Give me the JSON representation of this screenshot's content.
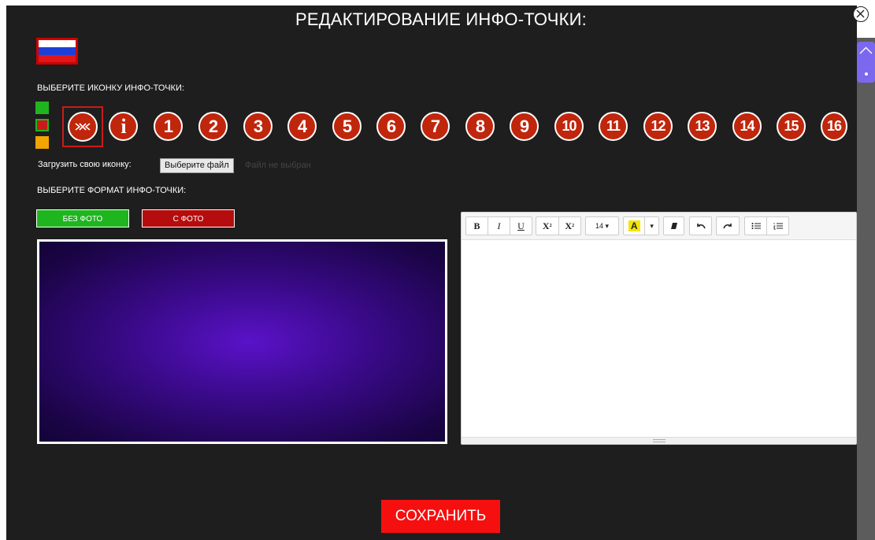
{
  "title": "РЕДАКТИРОВАНИЕ ИНФО-ТОЧКИ:",
  "close_icon": "close-circle-icon",
  "flag_icon": "russian-flag-icon",
  "flag_colors": [
    "#ffffff",
    "#1e3fd6",
    "#e0161b"
  ],
  "icon_section_label": "ВЫБЕРИТЕ ИКОНКУ ИНФО-ТОЧКИ:",
  "color_options": [
    {
      "name": "green",
      "hex": "#1fb51f"
    },
    {
      "name": "red",
      "hex": "#cc1a1a",
      "selected": true
    },
    {
      "name": "orange",
      "hex": "#f0a500"
    }
  ],
  "icons": {
    "selected": "cross-icon",
    "info": "i",
    "numbers": [
      "1",
      "2",
      "3",
      "4",
      "5",
      "6",
      "7",
      "8",
      "9",
      "10",
      "11",
      "12",
      "13",
      "14",
      "15",
      "16"
    ]
  },
  "upload": {
    "label": "Загрузить свою иконку:",
    "button": "Выберите файл",
    "status": "Файл не выбран"
  },
  "format_section_label": "ВЫБЕРИТЕ ФОРМАТ ИНФО-ТОЧКИ:",
  "format_buttons": {
    "no_photo": "БЕЗ ФОТО",
    "with_photo": "С ФОТО"
  },
  "editor": {
    "bold": "B",
    "italic": "I",
    "underline": "U",
    "superscript": "X",
    "subscript": "X",
    "font_size": "14 ▾",
    "highlight": "A",
    "dropdown": "▾",
    "eraser_icon": "eraser-icon",
    "undo_icon": "undo-icon",
    "redo_icon": "redo-icon",
    "ul_icon": "unordered-list-icon",
    "ol_icon": "ordered-list-icon"
  },
  "save_button": "СОХРАНИТЬ"
}
